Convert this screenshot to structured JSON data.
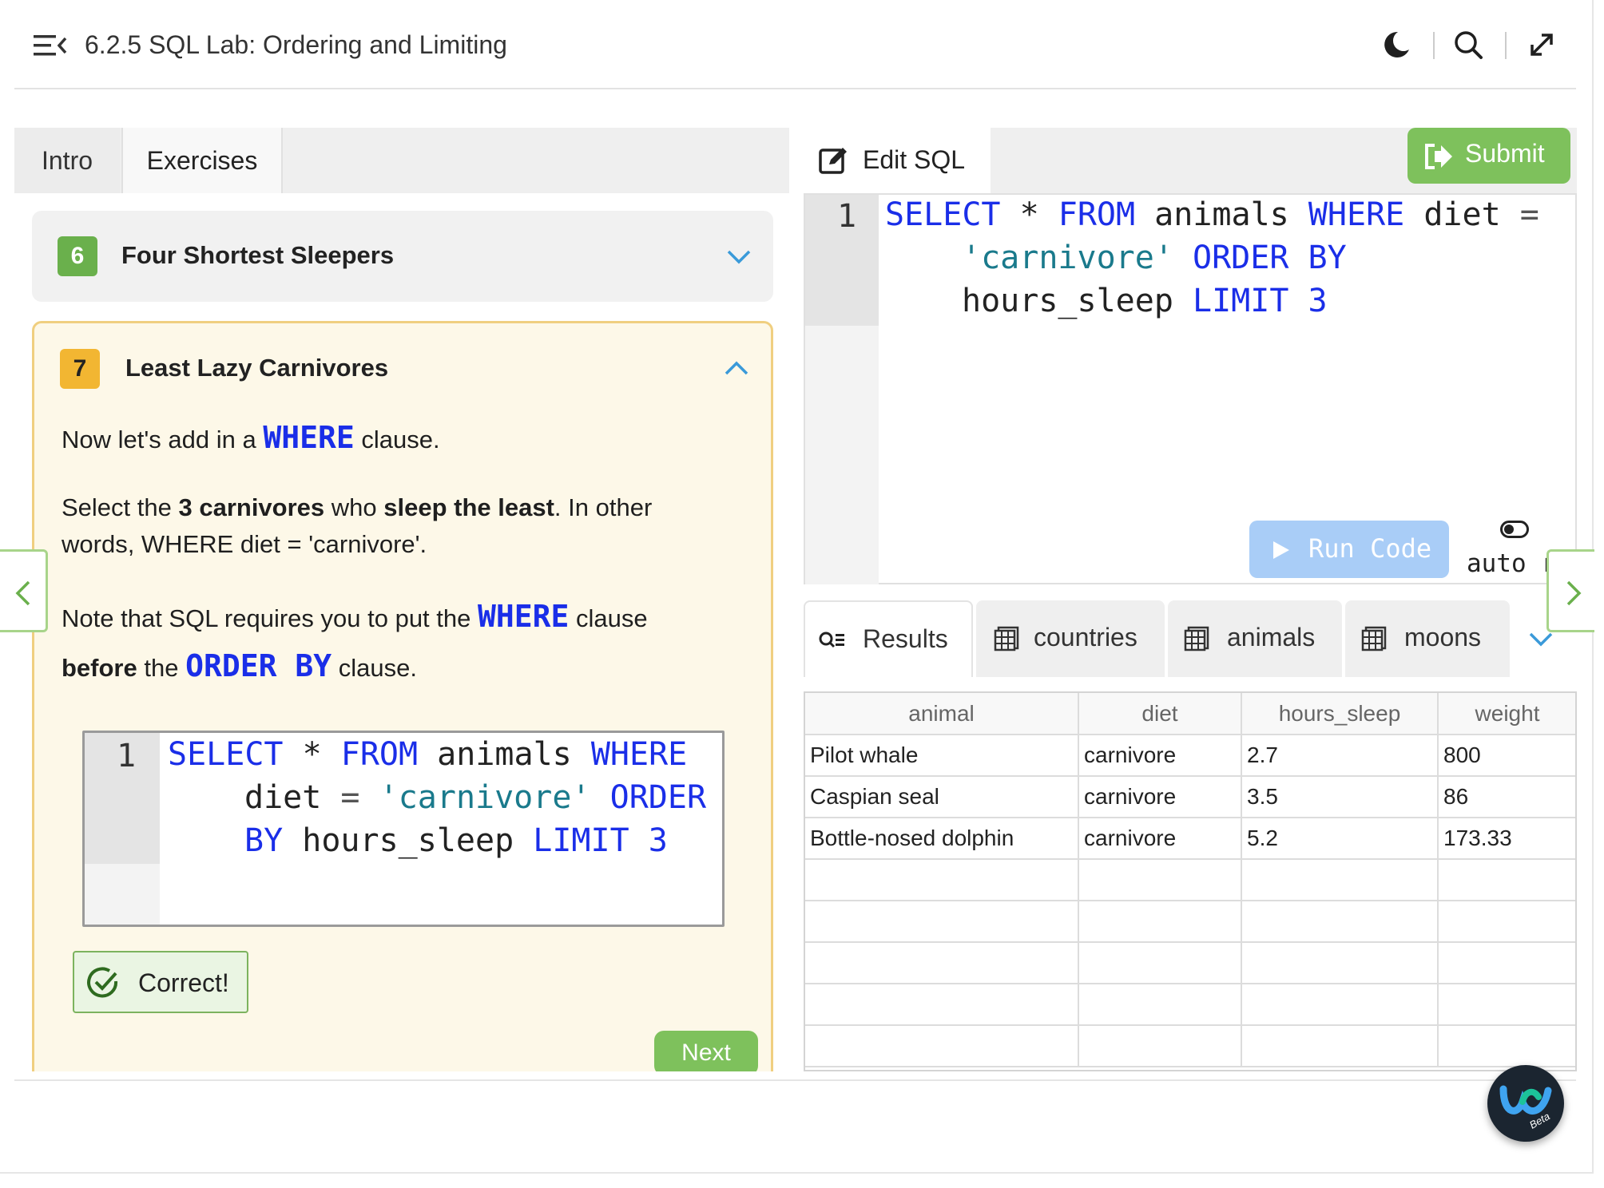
{
  "header": {
    "title": "6.2.5 SQL Lab: Ordering and Limiting"
  },
  "left": {
    "tabs": [
      "Intro",
      "Exercises"
    ],
    "exercise6": {
      "number": "6",
      "title": "Four Shortest Sleepers",
      "color": "#6ab04c"
    },
    "exercise7": {
      "number": "7",
      "title": "Least Lazy Carnivores",
      "color": "#f2b632",
      "p1_a": "Now let's add in a ",
      "p1_kw": "WHERE",
      "p1_b": " clause.",
      "p2_a": "Select the ",
      "p2_b1": "3 carnivores",
      "p2_c": " who ",
      "p2_b2": "sleep the least",
      "p2_d": ". In other",
      "p2_line2": "words, WHERE diet = 'carnivore'.",
      "p3_a": "Note that SQL requires you to put the ",
      "p3_kw": "WHERE",
      "p3_b": " clause",
      "p4_bold": "before",
      "p4_a": " the ",
      "p4_kw": "ORDER BY",
      "p4_b": " clause.",
      "code_line_number": "1",
      "correct": "Correct!",
      "next": "Next"
    }
  },
  "editor": {
    "tab_label": "Edit SQL",
    "submit": "Submit",
    "line_number": "1",
    "run": "Run Code",
    "auto_run": "auto run"
  },
  "results": {
    "tabs": [
      "Results",
      "countries",
      "animals",
      "moons"
    ],
    "columns": [
      "animal",
      "diet",
      "hours_sleep",
      "weight"
    ],
    "rows": [
      [
        "Pilot whale",
        "carnivore",
        "2.7",
        "800"
      ],
      [
        "Caspian seal",
        "carnivore",
        "3.5",
        "86"
      ],
      [
        "Bottle-nosed dolphin",
        "carnivore",
        "5.2",
        "173.33"
      ]
    ]
  },
  "badge": {
    "beta": "Beta"
  },
  "colors": {
    "accent_green": "#7ec15c",
    "keyword_blue": "#1a2ee8",
    "string_teal": "#1a7a8c",
    "run_blue": "#a9cdf7"
  }
}
